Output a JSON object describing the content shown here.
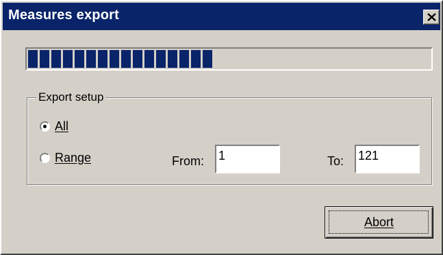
{
  "window": {
    "title": "Measures export",
    "close_icon": "close-icon"
  },
  "progress": {
    "fraction": 0.49,
    "filled_blocks": 16,
    "color": "#0a246a"
  },
  "export_setup": {
    "group_label": "Export setup",
    "options": [
      {
        "label": "All",
        "selected": true
      },
      {
        "label": "Range",
        "selected": false
      }
    ],
    "from_label": "From:",
    "from_value": "1",
    "to_label": "To:",
    "to_value": "121"
  },
  "buttons": {
    "abort_label": "Abort"
  }
}
